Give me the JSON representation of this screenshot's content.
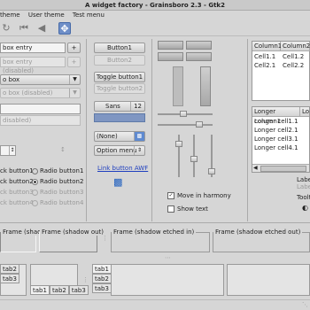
{
  "window": {
    "title": "A widget factory - Grainsboro 2.3 - Gtk2"
  },
  "menubar": {
    "items": [
      "theme",
      "User theme",
      "Test menu"
    ]
  },
  "entries": {
    "entry1": "box entry",
    "entry2": "box entry (disabled)",
    "combo1": "o box",
    "combo2": "o box (disabled)",
    "entry3": "",
    "entry4": "disabled)"
  },
  "buttons": {
    "button1": "Button1",
    "button2": "Button2",
    "toggle1": "Toggle button1",
    "toggle2": "Toggle button2",
    "font": "Sans",
    "font_size": "12",
    "combo_none": "(None)",
    "option_menu": "Option menu",
    "link": "Link button AWF"
  },
  "radios": {
    "check1": "ck button1",
    "check2": "ck button2",
    "check3": "ck button3",
    "check4": "ck button4",
    "radio1": "Radio button1",
    "radio2": "Radio button2",
    "radio3": "Radio button3",
    "radio4": "Radio button4"
  },
  "harmony": {
    "move": "Move in harmony",
    "show_text": "Show text"
  },
  "list1": {
    "columns": [
      "Column1",
      "Column2"
    ],
    "rows": [
      [
        "Cell1.1",
        "Cell1.2"
      ],
      [
        "Cell2.1",
        "Cell2.2"
      ]
    ]
  },
  "list2": {
    "columns": [
      "Longer column1",
      "Lon"
    ],
    "rows": [
      "Longer cell1.1",
      "Longer cell2.1",
      "Longer cell3.1",
      "Longer cell4.1"
    ]
  },
  "right_labels": {
    "label": "Labe",
    "label_sub": "Label",
    "tooltip": "Toolti"
  },
  "frames": {
    "shadow_in": "Frame (shadow in)",
    "shadow_out": "Frame (shadow out)",
    "etched_in": "Frame (shadow etched in)",
    "etched_out": "Frame (shadow etched out)"
  },
  "tabs": {
    "set1": [
      "tab2",
      "tab3"
    ],
    "set2": [
      "tab1",
      "tab2",
      "tab3"
    ],
    "set3": [
      "tab1",
      "tab2",
      "tab3"
    ]
  }
}
